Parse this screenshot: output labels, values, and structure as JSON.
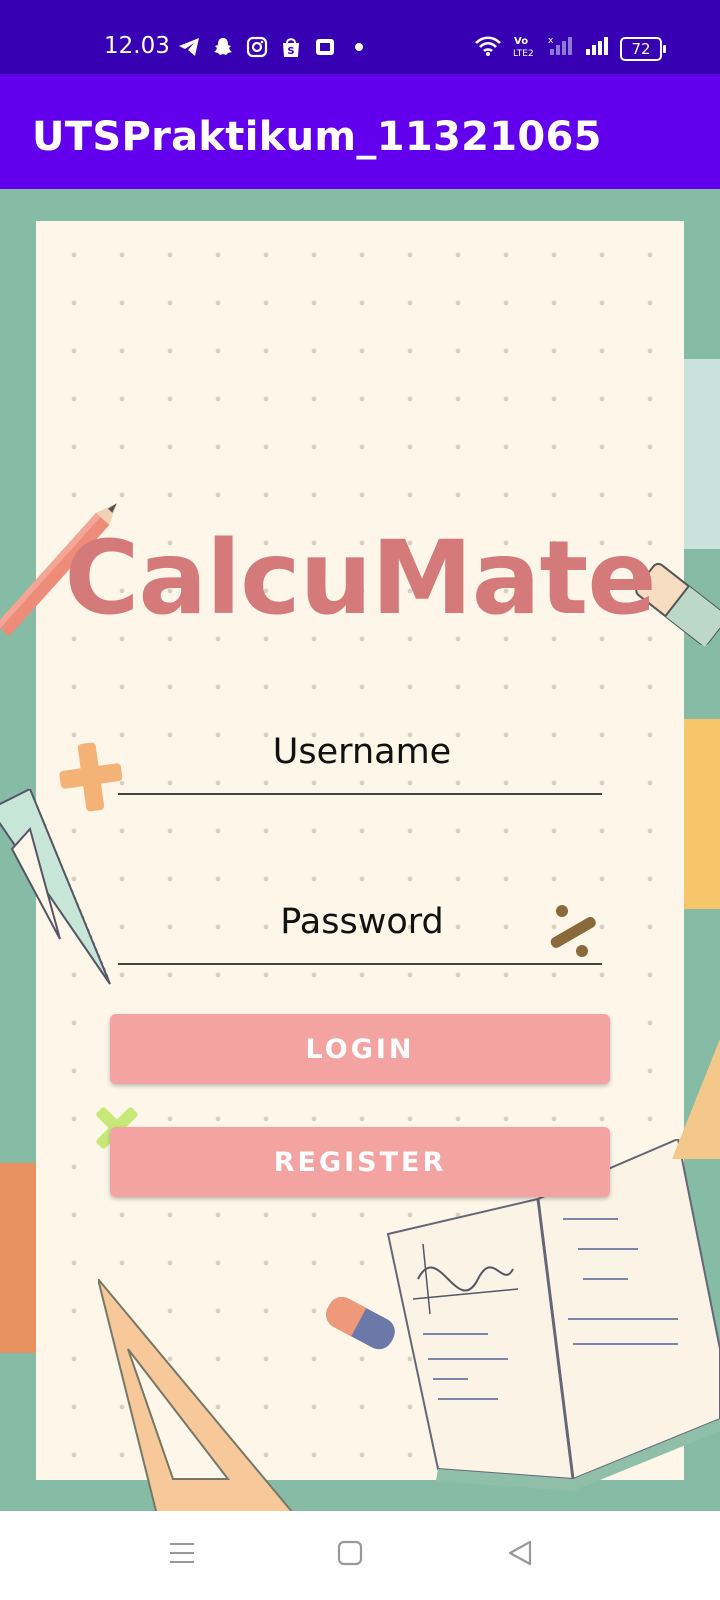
{
  "status_bar": {
    "time": "12.03",
    "battery": "72"
  },
  "app_bar": {
    "title": "UTSPraktikum_11321065"
  },
  "login_screen": {
    "brand": "CalcuMate",
    "username": {
      "placeholder": "Username",
      "value": ""
    },
    "password": {
      "placeholder": "Password",
      "value": ""
    },
    "login_label": "LOGIN",
    "register_label": "REGISTER"
  },
  "colors": {
    "status_bar": "#3700b3",
    "app_bar": "#6200ee",
    "background": "#86bba5",
    "paper": "#fdf6e9",
    "brand": "#d47a7a",
    "button": "#f4a3a3"
  },
  "icons": {
    "status_left": [
      "telegram-icon",
      "snapchat-icon",
      "instagram-icon",
      "shopee-icon",
      "app-icon",
      "dot-icon"
    ],
    "status_right": [
      "wifi-icon",
      "volte-icon",
      "signal-icon",
      "signal-icon",
      "battery-icon"
    ],
    "nav": [
      "menu-icon",
      "home-icon",
      "back-icon"
    ]
  }
}
